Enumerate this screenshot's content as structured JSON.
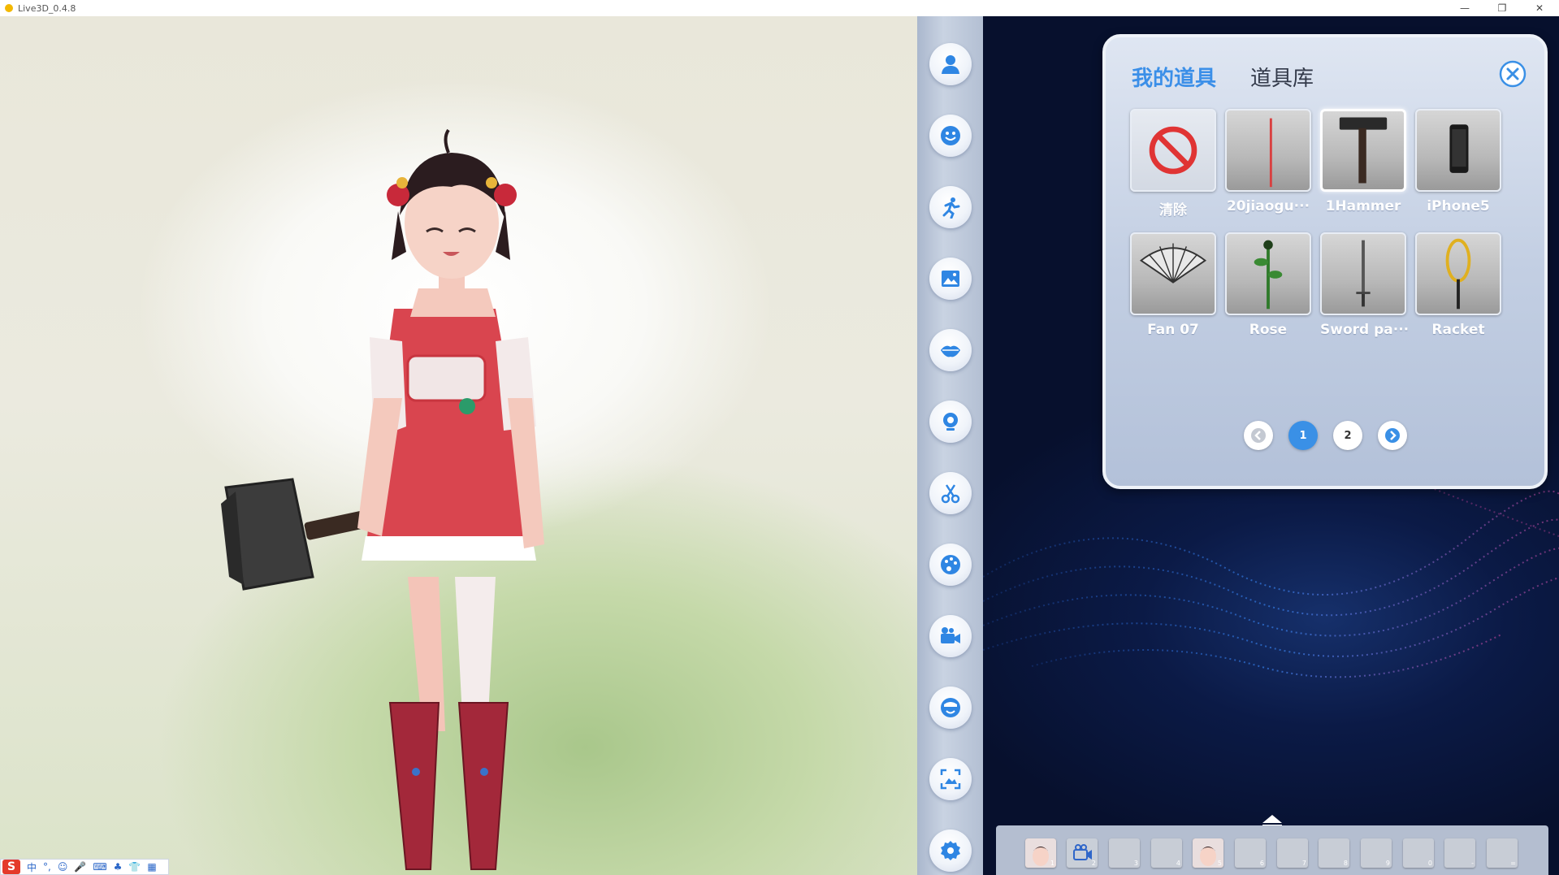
{
  "window": {
    "title": "Live3D_0.4.8",
    "min_glyph": "—",
    "max_glyph": "❐",
    "close_glyph": "✕"
  },
  "colors": {
    "accent": "#3a90e6",
    "toolbar": "#b8c3d6",
    "stage_bg": "#0b1a46",
    "panel_bg": "#c3cfe3"
  },
  "toolbar": {
    "items": [
      {
        "name": "character",
        "icon": "person-icon"
      },
      {
        "name": "expression",
        "icon": "face-icon"
      },
      {
        "name": "motion",
        "icon": "running-icon"
      },
      {
        "name": "background",
        "icon": "image-icon"
      },
      {
        "name": "lip-sync",
        "icon": "lips-icon"
      },
      {
        "name": "webcam",
        "icon": "webcam-icon"
      },
      {
        "name": "props",
        "icon": "scissors-icon"
      },
      {
        "name": "effects",
        "icon": "palette-icon"
      },
      {
        "name": "camera",
        "icon": "video-camera-icon"
      },
      {
        "name": "avatar-face",
        "icon": "avatar-icon"
      },
      {
        "name": "screenshot",
        "icon": "capture-icon"
      },
      {
        "name": "settings",
        "icon": "gear-icon"
      }
    ]
  },
  "props_panel": {
    "tab_my_props": "我的道具",
    "tab_prop_library": "道具库",
    "items": [
      {
        "label": "清除",
        "thumb": "no-icon"
      },
      {
        "label": "20jiaogu···",
        "thumb": "stick"
      },
      {
        "label": "1Hammer",
        "thumb": "hammer",
        "selected": true
      },
      {
        "label": "iPhone5",
        "thumb": "phone"
      },
      {
        "label": "Fan 07",
        "thumb": "fan"
      },
      {
        "label": "Rose",
        "thumb": "rose"
      },
      {
        "label": "Sword pa···",
        "thumb": "sword"
      },
      {
        "label": "Racket",
        "thumb": "racket"
      }
    ],
    "pagination": {
      "pages": [
        "1",
        "2"
      ],
      "current": "1"
    }
  },
  "slot_bar": {
    "slots": [
      {
        "num": "1",
        "filled": true
      },
      {
        "num": "2",
        "filled": true
      },
      {
        "num": "3",
        "filled": false
      },
      {
        "num": "4",
        "filled": false
      },
      {
        "num": "5",
        "filled": true
      },
      {
        "num": "6",
        "filled": false
      },
      {
        "num": "7",
        "filled": false
      },
      {
        "num": "8",
        "filled": false
      },
      {
        "num": "9",
        "filled": false
      },
      {
        "num": "0",
        "filled": false
      },
      {
        "num": "-",
        "filled": false
      },
      {
        "num": "=",
        "filled": false
      }
    ]
  },
  "ime": {
    "logo": "S",
    "mode": "中",
    "punct": "°,",
    "emoji": "☺",
    "mic": "🎤",
    "keyboard": "⌨",
    "user": "♣",
    "shirt": "👕",
    "grid": "▦"
  }
}
